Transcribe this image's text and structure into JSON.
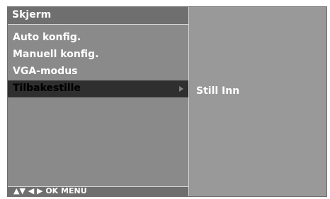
{
  "osd": {
    "title": "Skjerm",
    "menu_items": [
      {
        "label": "Auto konfig.",
        "selected": false
      },
      {
        "label": "Manuell konfig.",
        "selected": false
      },
      {
        "label": "VGA-modus",
        "selected": false
      },
      {
        "label": "Tilbakestille",
        "selected": true
      }
    ],
    "footer_hint": "▲▼  ◀ ▶  OK  MENU",
    "submenu": {
      "item": "Still Inn"
    },
    "colors": {
      "panel_bg": "#8a8a8a",
      "header_bg": "#6f6f6f",
      "selected_bg": "#2f2f2f",
      "right_panel_bg": "#999999",
      "text": "#ffffff"
    }
  }
}
